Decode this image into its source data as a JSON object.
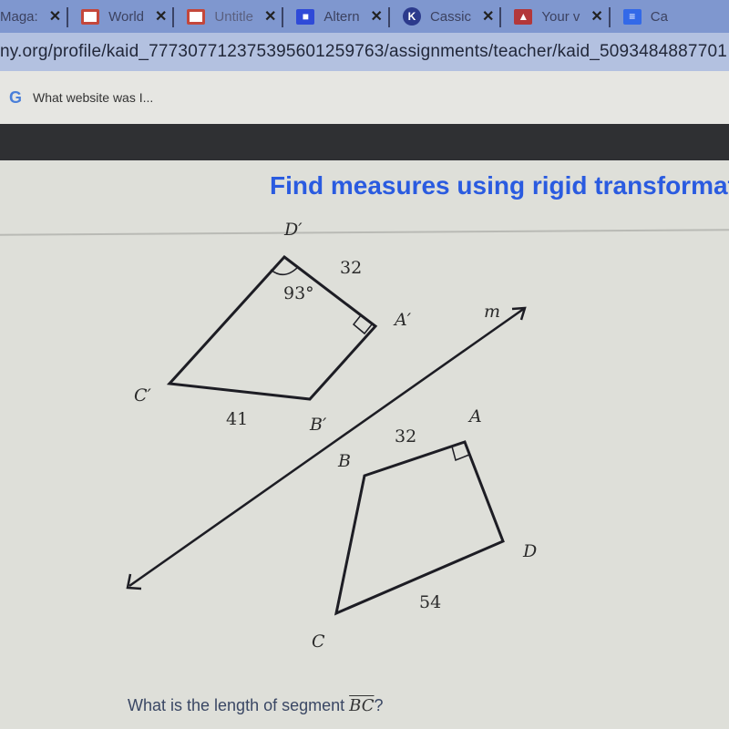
{
  "browser": {
    "tabs": [
      {
        "label": "Maga:",
        "icon": "none",
        "close": "✕"
      },
      {
        "label": "World",
        "icon": "slides-icon",
        "color": "#c4473b",
        "close": "✕"
      },
      {
        "label": "Untitle",
        "icon": "slides-icon",
        "color": "#c4473b",
        "close": "✕"
      },
      {
        "label": "Altern",
        "icon": "classroom-icon",
        "color": "#2f4ad8",
        "close": "✕"
      },
      {
        "label": "Cassic",
        "icon": "khan-academy-icon",
        "color": "#2c3a8c",
        "close": "✕"
      },
      {
        "label": "Your v",
        "icon": "classroom-assignment-icon",
        "color": "#b3373a",
        "close": "✕"
      },
      {
        "label": "Ca",
        "icon": "docs-icon",
        "color": "#3369e8",
        "close": ""
      }
    ],
    "url": "ny.org/profile/kaid_777307712375395601259763/assignments/teacher/kaid_5093484887701",
    "bookmarks": [
      {
        "label": "What website was I...",
        "icon": "google-icon"
      }
    ]
  },
  "page": {
    "title": "Find measures using rigid transformations",
    "question_prefix": "What is the length of segment ",
    "question_segment": "BC",
    "question_suffix": "?"
  },
  "figure": {
    "image_quad": {
      "vertex_labels": {
        "D": "D′",
        "A": "A′",
        "B": "B′",
        "C": "C′"
      },
      "angle_label": "93°",
      "side_labels": {
        "DA": "32",
        "CB": "41"
      }
    },
    "line_label": "m",
    "original_quad": {
      "vertex_labels": {
        "A": "A",
        "B": "B",
        "C": "C",
        "D": "D"
      },
      "side_labels": {
        "AB": "32",
        "CD": "54"
      }
    }
  }
}
